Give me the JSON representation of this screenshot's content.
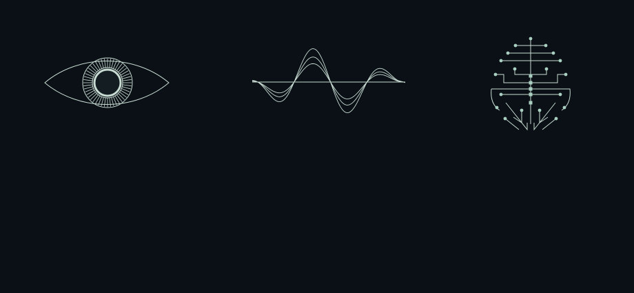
{
  "colors": {
    "background": "#0a1016",
    "line": "#c9dcd3",
    "accent": "#a9cfc1"
  },
  "icons": {
    "vision": "eye-icon",
    "signal": "sine-wave-icon",
    "intelligence": "circuit-brain-icon"
  }
}
